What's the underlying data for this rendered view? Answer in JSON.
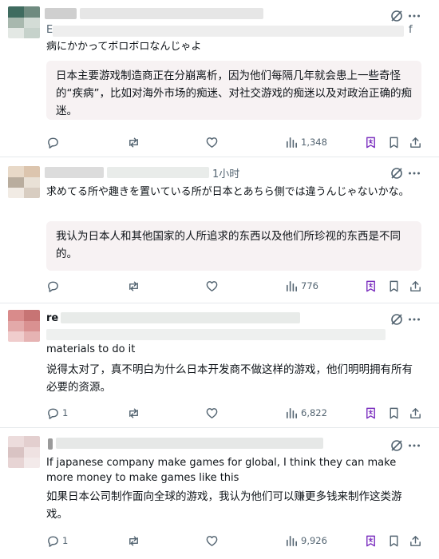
{
  "posts": [
    {
      "name": "",
      "time": "",
      "text_fragment_top_left": "E",
      "text_fragment_top_right": "f",
      "original_text": "病にかかってボロボロなんじゃよ",
      "translation": "日本主要游戏制造商正在分崩离析，因为他们每隔几年就会患上一些奇怪的“疾病”，比如对海外市场的痴迷、对社交游戏的痴迷以及对政治正确的痴迷。",
      "reply_count": "",
      "repost_count": "",
      "like_count": "",
      "view_count": "1,348"
    },
    {
      "name": "",
      "time": "1小时",
      "original_text": "求めてる所や趣きを置いている所が日本とあちら側では違うんじゃないかな。",
      "translation": "我认为日本人和其他国家的人所追求的东西以及他们所珍视的东西是不同的。",
      "reply_count": "",
      "repost_count": "",
      "like_count": "",
      "view_count": "776"
    },
    {
      "name": "re",
      "time": "",
      "original_text": "materials to do it",
      "translation": "说得太对了，真不明白为什么日本开发商不做这样的游戏，他们明明拥有所有必要的资源。",
      "reply_count": "1",
      "repost_count": "",
      "like_count": "",
      "view_count": "6,822"
    },
    {
      "name": "",
      "time": "",
      "original_text": "If japanese company make games for global, I think they can make more money to make games like this",
      "translation": "如果日本公司制作面向全球的游戏，我认为他们可以赚更多钱来制作这类游戏。",
      "reply_count": "1",
      "repost_count": "",
      "like_count": "",
      "view_count": "9,926"
    }
  ],
  "colors": {
    "text": "#0f1419",
    "muted": "#536471",
    "translation_bg": "#f7f2f3",
    "bookmark_accent": "#7b2fbf",
    "divider": "#e6e9ec"
  },
  "icons": {
    "grok": "grok-slash-circle-icon",
    "more": "more-dots-icon",
    "reply": "reply-bubble-icon",
    "repost": "repost-arrows-icon",
    "like": "heart-icon",
    "views": "bar-chart-icon",
    "translate_bookmark": "translate-bookmark-icon",
    "bookmark": "bookmark-icon",
    "share": "share-upload-icon"
  }
}
